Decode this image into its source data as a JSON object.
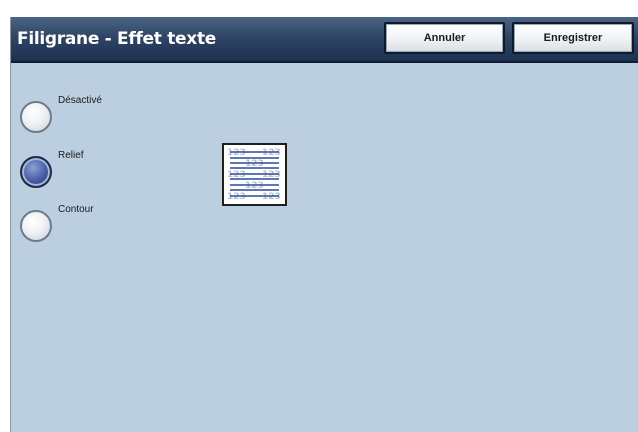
{
  "header": {
    "title": "Filigrane - Effet texte",
    "cancel_label": "Annuler",
    "save_label": "Enregistrer"
  },
  "options": [
    {
      "label": "Désactivé",
      "selected": false
    },
    {
      "label": "Relief",
      "selected": true
    },
    {
      "label": "Contour",
      "selected": false
    }
  ],
  "preview": {
    "icon": "watermark-relief-preview-icon",
    "sample_text": "123"
  },
  "colors": {
    "panel_background": "#bccfe0",
    "title_bar": "#2e4565",
    "selected_radio": "#4a5fa8",
    "preview_lines": "#2a4a9a"
  }
}
